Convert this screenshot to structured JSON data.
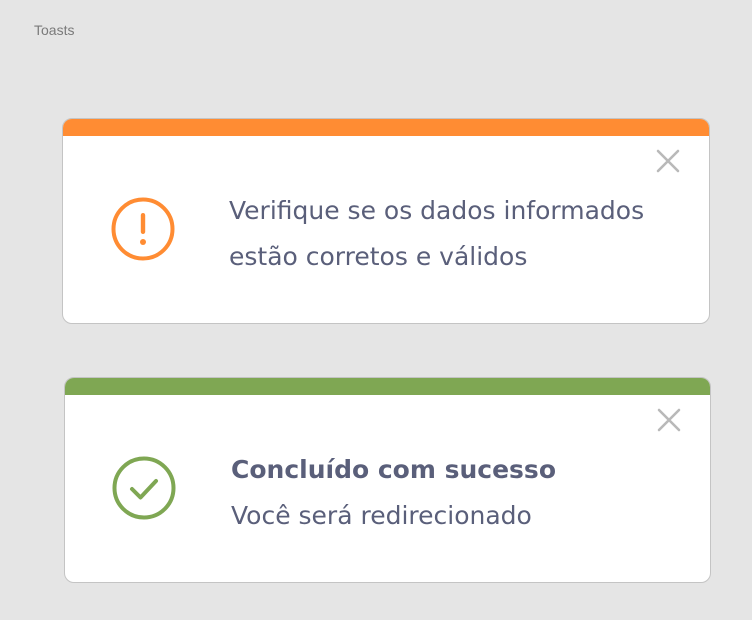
{
  "frame": {
    "label": "Toasts"
  },
  "toasts": [
    {
      "type": "warning",
      "accent_color": "#ff8c33",
      "icon": "exclamation-circle-icon",
      "close_icon": "close-icon",
      "title": "",
      "lines": [
        "Verifique se os dados informados",
        "estão corretos e válidos"
      ]
    },
    {
      "type": "success",
      "accent_color": "#7fa753",
      "icon": "check-circle-icon",
      "close_icon": "close-icon",
      "title": "Concluído com sucesso",
      "lines": [
        "Você será redirecionado"
      ]
    }
  ]
}
